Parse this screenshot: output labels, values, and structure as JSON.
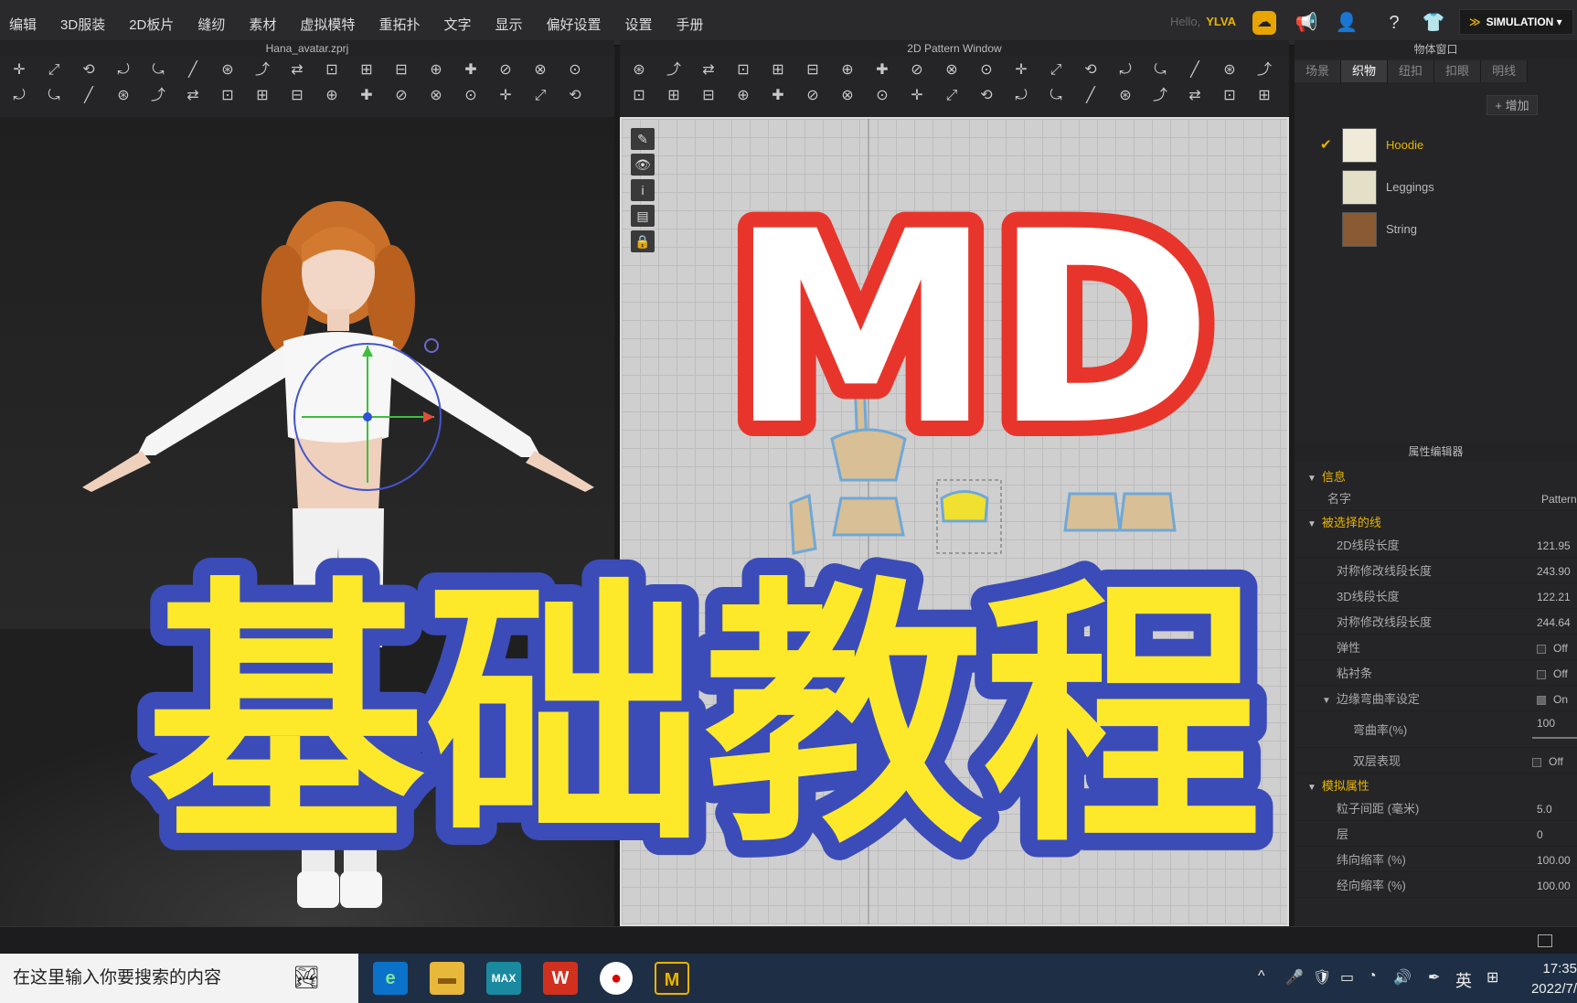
{
  "menu": [
    "编辑",
    "3D服装",
    "2D板片",
    "缝纫",
    "素材",
    "虚拟模特",
    "重拓扑",
    "文字",
    "显示",
    "偏好设置",
    "设置",
    "手册"
  ],
  "user": {
    "greeting": "Hello,",
    "name": "YLVA"
  },
  "simulation_label": "SIMULATION",
  "panels": {
    "viewport3d_title": "Hana_avatar.zprj",
    "pattern2d_title": "2D Pattern Window",
    "object_window_title": "物体窗口",
    "property_editor_title": "属性编辑器"
  },
  "object_tabs": [
    "场景",
    "织物",
    "纽扣",
    "扣眼",
    "明线"
  ],
  "add_button": "+ 增加",
  "fabrics": [
    {
      "name": "Hoodie",
      "selected": true
    },
    {
      "name": "Leggings",
      "selected": false
    },
    {
      "name": "String",
      "selected": false
    }
  ],
  "properties": {
    "info_section": "信息",
    "name_label": "名字",
    "name_value": "Pattern",
    "selected_line_section": "被选择的线",
    "len2d_label": "2D线段长度",
    "len2d_value": "121.95",
    "sym2d_label": "对称修改线段长度",
    "sym2d_value": "243.90",
    "len3d_label": "3D线段长度",
    "len3d_value": "122.21",
    "sym3d_label": "对称修改线段长度",
    "sym3d_value": "244.64",
    "elastic_label": "弹性",
    "elastic_value": "Off",
    "tape_label": "粘衬条",
    "tape_value": "Off",
    "curve_label": "边缘弯曲率设定",
    "curve_value": "On",
    "curvature_label": "弯曲率(%)",
    "curvature_value": "100",
    "double_label": "双层表现",
    "double_value": "Off",
    "sim_section": "模拟属性",
    "particle_label": "粒子间距 (毫米)",
    "particle_value": "5.0",
    "layer_label": "层",
    "layer_value": "0",
    "weft_label": "纬向缩率 (%)",
    "weft_value": "100.00",
    "warp_label": "经向缩率 (%)",
    "warp_value": "100.00"
  },
  "overlay": {
    "logo": "MD",
    "title": "基础教程"
  },
  "taskbar": {
    "search_placeholder": "在这里输入你要搜索的内容",
    "ime_label": "英",
    "time": "17:35",
    "date": "2022/7/"
  },
  "colors": {
    "accent": "#e8b400",
    "title_yellow": "#fde92a",
    "title_blue": "#3b4cb8",
    "logo_red": "#e8352b"
  }
}
